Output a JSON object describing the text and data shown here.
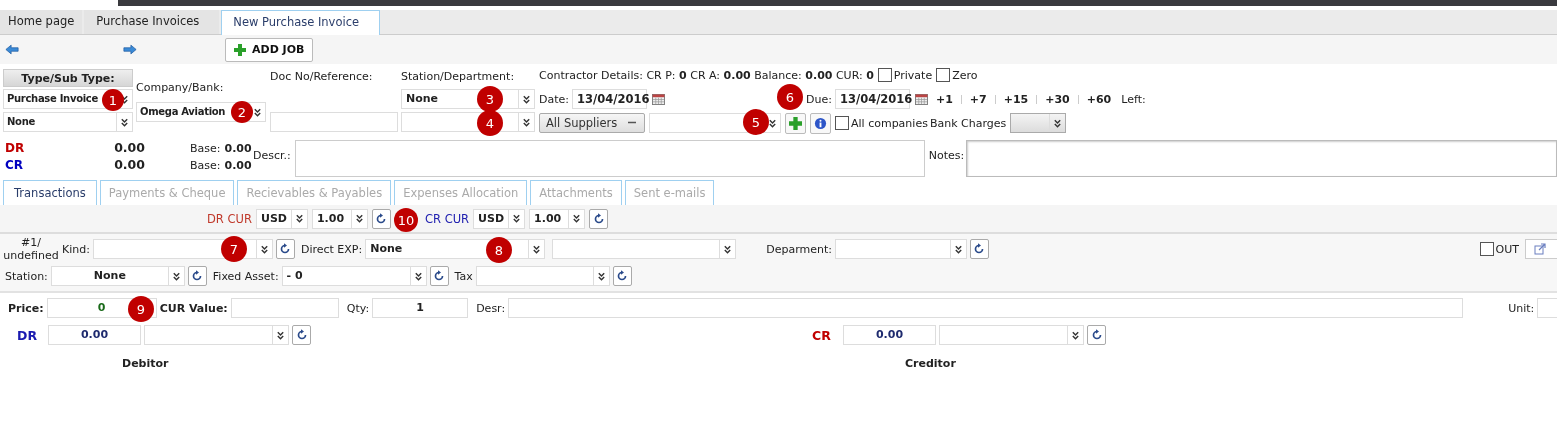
{
  "top_tabs": [
    {
      "label": "Home page",
      "selected": false
    },
    {
      "label": "Purchase Invoices",
      "selected": false
    },
    {
      "label": "New Purchase Invoice",
      "selected": true
    }
  ],
  "toolbar": {
    "add_job": "ADD JOB"
  },
  "header": {
    "type_label": "Type/Sub Type:",
    "type": "Purchase Invoice",
    "sub_type": "None",
    "company_label": "Company/Bank:",
    "company": "Omega Aviation",
    "doc_label": "Doc No/Reference:",
    "station_label": "Station/Department:",
    "station": "None",
    "contractor": "Contractor Details: CR P: **0** CR A: **0.00** Balance: **0.00** CUR: **0**",
    "private": {
      "label": "Private",
      "checked": false
    },
    "zero": {
      "label": "Zero",
      "checked": false
    },
    "date_label": "Date:",
    "date": "13/04/2016",
    "due_label": "Due:",
    "due": "13/04/2016",
    "due_shortcuts": [
      "+1",
      "+7",
      "+15",
      "+30",
      "+60"
    ],
    "left_label": "Left:",
    "supplier_filter": "All Suppliers",
    "all_companies": {
      "label": "All companies",
      "checked": false
    },
    "bank_charges_label": "Bank Charges",
    "totals": [
      {
        "label": "DR",
        "amount": "0.00",
        "base_label": "Base:",
        "base": "0.00",
        "color": "#c00000"
      },
      {
        "label": "CR",
        "amount": "0.00",
        "base_label": "Base:",
        "base": "0.00",
        "color": "#0000c0"
      }
    ],
    "descr_label": "Descr.:",
    "notes_label": "Notes:"
  },
  "section_tabs": [
    {
      "label": "Transactions",
      "selected": true
    },
    {
      "label": "Payments & Cheque",
      "selected": false
    },
    {
      "label": "Recievables & Payables",
      "selected": false
    },
    {
      "label": "Expenses Allocation",
      "selected": false
    },
    {
      "label": "Attachments",
      "selected": false
    },
    {
      "label": "Sent e-mails",
      "selected": false
    }
  ],
  "currency": [
    {
      "label": "DR CUR",
      "code": "USD",
      "rate": "1.00",
      "color": "#c0392b"
    },
    {
      "label": "CR CUR",
      "code": "USD",
      "rate": "1.00",
      "color": "#2020b0"
    }
  ],
  "line": {
    "number": "#1/",
    "status": "undefined",
    "kind_label": "Kind:",
    "direct_exp_label": "Direct EXP:",
    "direct_exp": "None",
    "department_label": "Deparment:",
    "out": {
      "label": "OUT",
      "checked": false
    },
    "station_label": "Station:",
    "station": "None",
    "fixed_asset_label": "Fixed Asset:",
    "fixed_asset": "- 0",
    "tax_label": "Tax",
    "price_label": "Price:",
    "price": "0",
    "cur_value_label": "CUR Value:",
    "qty_label": "Qty:",
    "qty": "1",
    "desr_label": "Desr:",
    "unit_label": "Unit:"
  },
  "accounts": [
    {
      "label": "DR",
      "amount": "0.00",
      "caption": "Debitor",
      "color": "#1a1ab0"
    },
    {
      "label": "CR",
      "amount": "0.00",
      "caption": "Creditor",
      "color": "#c00000"
    }
  ],
  "annotations": [
    "1",
    "2",
    "3",
    "4",
    "5",
    "6",
    "7",
    "8",
    "9",
    "10"
  ]
}
